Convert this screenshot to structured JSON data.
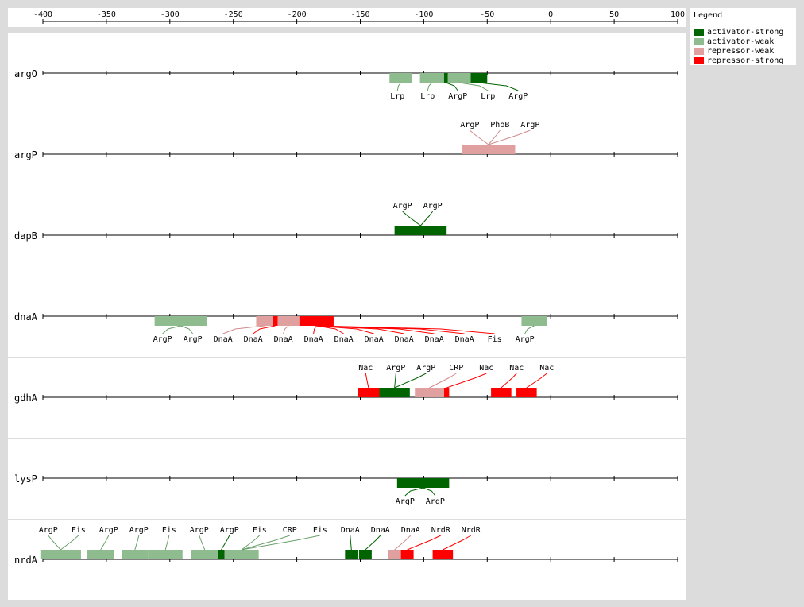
{
  "axis": {
    "min": -400,
    "max": 100,
    "ticks": [
      "-400",
      "-350",
      "-300",
      "-250",
      "-200",
      "-150",
      "-100",
      "-50",
      "0",
      "50",
      "100"
    ]
  },
  "legend": {
    "title": "Legend",
    "items": [
      {
        "label": "activator-strong",
        "color": "#006400"
      },
      {
        "label": "activator-weak",
        "color": "#8fbc8f"
      },
      {
        "label": "repressor-weak",
        "color": "#e0a0a0"
      },
      {
        "label": "repressor-strong",
        "color": "#ff0000"
      }
    ]
  },
  "tracks": [
    {
      "gene": "argO",
      "sites": [
        {
          "start": -127,
          "end": -109,
          "type": "activator-weak",
          "label": "Lrp",
          "lpos": "below"
        },
        {
          "start": -103,
          "end": -84,
          "type": "activator-weak",
          "label": "Lrp",
          "lpos": "below"
        },
        {
          "start": -84,
          "end": -81,
          "type": "activator-strong",
          "label": "ArgP",
          "lpos": "below"
        },
        {
          "start": -81,
          "end": -63,
          "type": "activator-weak",
          "label": "Lrp",
          "lpos": "below"
        },
        {
          "start": -63,
          "end": -50,
          "type": "activator-strong",
          "label": "ArgP",
          "lpos": "below"
        }
      ]
    },
    {
      "gene": "argP",
      "sites": [
        {
          "start": -70,
          "end": -28,
          "type": "repressor-weak",
          "label": "ArgP",
          "lpos": "above"
        },
        {
          "start": -70,
          "end": -28,
          "type": "repressor-weak",
          "label": "PhoB",
          "lpos": "above"
        },
        {
          "start": -70,
          "end": -28,
          "type": "repressor-weak",
          "label": "ArgP",
          "lpos": "above"
        }
      ]
    },
    {
      "gene": "dapB",
      "sites": [
        {
          "start": -123,
          "end": -82,
          "type": "activator-strong",
          "label": "ArgP",
          "lpos": "above"
        },
        {
          "start": -123,
          "end": -82,
          "type": "activator-strong",
          "label": "ArgP",
          "lpos": "above"
        }
      ]
    },
    {
      "gene": "dnaA",
      "sites": [
        {
          "start": -312,
          "end": -271,
          "type": "activator-weak",
          "label": "ArgP",
          "lpos": "below"
        },
        {
          "start": -312,
          "end": -271,
          "type": "activator-weak",
          "label": "ArgP",
          "lpos": "below"
        },
        {
          "start": -232,
          "end": -219,
          "type": "repressor-weak",
          "label": "DnaA",
          "lpos": "below"
        },
        {
          "start": -219,
          "end": -215,
          "type": "repressor-strong",
          "label": "DnaA",
          "lpos": "below"
        },
        {
          "start": -215,
          "end": -198,
          "type": "repressor-weak",
          "label": "DnaA",
          "lpos": "below"
        },
        {
          "start": -198,
          "end": -171,
          "type": "repressor-strong",
          "label": "DnaA",
          "lpos": "below"
        },
        {
          "start": -198,
          "end": -171,
          "type": "repressor-strong",
          "label": "DnaA",
          "lpos": "below"
        },
        {
          "start": -198,
          "end": -171,
          "type": "repressor-strong",
          "label": "DnaA",
          "lpos": "below"
        },
        {
          "start": -198,
          "end": -171,
          "type": "repressor-strong",
          "label": "DnaA",
          "lpos": "below"
        },
        {
          "start": -198,
          "end": -171,
          "type": "repressor-strong",
          "label": "DnaA",
          "lpos": "below"
        },
        {
          "start": -198,
          "end": -171,
          "type": "repressor-strong",
          "label": "DnaA",
          "lpos": "below"
        },
        {
          "start": -198,
          "end": -171,
          "type": "repressor-strong",
          "label": "Fis",
          "lpos": "below"
        },
        {
          "start": -23,
          "end": -3,
          "type": "activator-weak",
          "label": "ArgP",
          "lpos": "below"
        }
      ]
    },
    {
      "gene": "gdhA",
      "sites": [
        {
          "start": -152,
          "end": -135,
          "type": "repressor-strong",
          "label": "Nac",
          "lpos": "above"
        },
        {
          "start": -135,
          "end": -111,
          "type": "activator-strong",
          "label": "ArgP",
          "lpos": "above"
        },
        {
          "start": -135,
          "end": -111,
          "type": "activator-strong",
          "label": "ArgP",
          "lpos": "above"
        },
        {
          "start": -107,
          "end": -84,
          "type": "repressor-weak",
          "label": "CRP",
          "lpos": "above"
        },
        {
          "start": -84,
          "end": -80,
          "type": "repressor-strong",
          "label": "Nac",
          "lpos": "above"
        },
        {
          "start": -47,
          "end": -31,
          "type": "repressor-strong",
          "label": "Nac",
          "lpos": "above"
        },
        {
          "start": -27,
          "end": -11,
          "type": "repressor-strong",
          "label": "Nac",
          "lpos": "above"
        }
      ]
    },
    {
      "gene": "lysP",
      "sites": [
        {
          "start": -121,
          "end": -80,
          "type": "activator-strong",
          "label": "ArgP",
          "lpos": "below"
        },
        {
          "start": -121,
          "end": -80,
          "type": "activator-strong",
          "label": "ArgP",
          "lpos": "below"
        }
      ]
    },
    {
      "gene": "nrdA",
      "sites": [
        {
          "start": -402,
          "end": -370,
          "type": "activator-weak",
          "label": "ArgP",
          "lpos": "above"
        },
        {
          "start": -402,
          "end": -370,
          "type": "activator-weak",
          "label": "Fis",
          "lpos": "above"
        },
        {
          "start": -365,
          "end": -344,
          "type": "activator-weak",
          "label": "ArgP",
          "lpos": "above"
        },
        {
          "start": -338,
          "end": -317,
          "type": "activator-weak",
          "label": "ArgP",
          "lpos": "above"
        },
        {
          "start": -317,
          "end": -290,
          "type": "activator-weak",
          "label": "Fis",
          "lpos": "above"
        },
        {
          "start": -283,
          "end": -262,
          "type": "activator-weak",
          "label": "ArgP",
          "lpos": "above"
        },
        {
          "start": -262,
          "end": -257,
          "type": "activator-strong",
          "label": "ArgP",
          "lpos": "above"
        },
        {
          "start": -257,
          "end": -230,
          "type": "activator-weak",
          "label": "Fis",
          "lpos": "above"
        },
        {
          "start": -257,
          "end": -230,
          "type": "activator-weak",
          "label": "CRP",
          "lpos": "above"
        },
        {
          "start": -257,
          "end": -230,
          "type": "activator-weak",
          "label": "Fis",
          "lpos": "above"
        },
        {
          "start": -162,
          "end": -152,
          "type": "activator-strong",
          "label": "DnaA",
          "lpos": "above"
        },
        {
          "start": -151,
          "end": -141,
          "type": "activator-strong",
          "label": "DnaA",
          "lpos": "above"
        },
        {
          "start": -128,
          "end": -118,
          "type": "repressor-weak",
          "label": "DnaA",
          "lpos": "above"
        },
        {
          "start": -118,
          "end": -108,
          "type": "repressor-strong",
          "label": "NrdR",
          "lpos": "above"
        },
        {
          "start": -93,
          "end": -77,
          "type": "repressor-strong",
          "label": "NrdR",
          "lpos": "above"
        }
      ]
    }
  ]
}
